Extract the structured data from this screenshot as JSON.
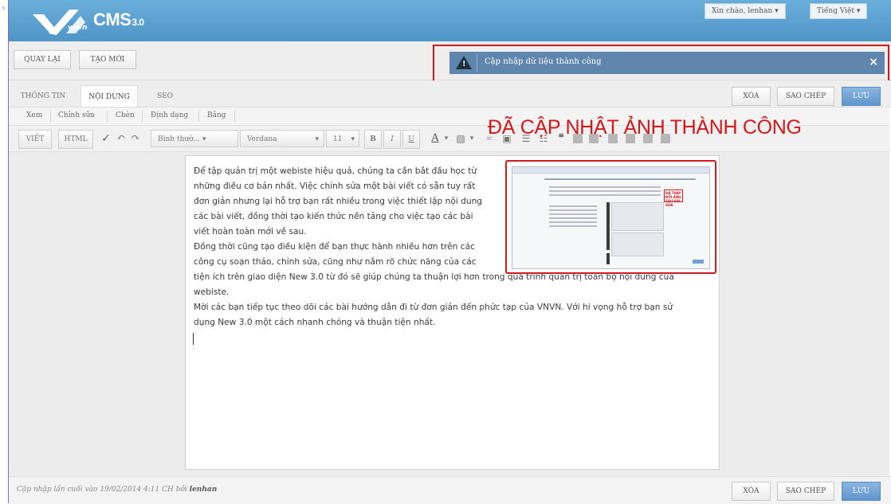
{
  "header": {
    "brand_small": "vnvn",
    "brand_name": "CMS",
    "brand_version": "3.0",
    "greeting": "Xin chào, lenhan",
    "language": "Tiếng Việt"
  },
  "actions": {
    "back": "QUAY LẠI",
    "new": "TẠO MỚI"
  },
  "notice": {
    "message": "Cập nhập dữ liệu thành công",
    "close": "×"
  },
  "annotation": "ĐÃ CẬP NHẬT ẢNH THÀNH CÔNG",
  "tabs": [
    "THÔNG TIN",
    "NỘI DUNG",
    "SEO"
  ],
  "record_actions": {
    "delete": "XÓA",
    "copy": "SAO CHÉP",
    "save": "LƯU"
  },
  "editor": {
    "menu": [
      "Xem",
      "Chỉnh sửa",
      "Chèn",
      "Định dạng",
      "Bảng"
    ],
    "mode_view": "VIẾT",
    "mode_html": "HTML",
    "format_select": "Bình thườ...",
    "font_select": "Verdana",
    "size_select": "11",
    "bold": "B",
    "italic": "I",
    "underline": "U",
    "font_color": "A"
  },
  "content": {
    "lines": [
      "Để tập quản trị một webiste hiệu quả, chúng ta cần bắt đầu học từ",
      "những điều cơ bản nhất. Việc chỉnh sửa một bài viết có sẵn tuy rất",
      "đơn giản nhưng lại hỗ trợ bạn rất nhiều trong việc thiết lập nội dung",
      "các bài viết, đồng thời tạo kiến thức nền tảng cho việc tạo các bài",
      "viết hoàn toàn mới về sau.",
      "Đồng thời cũng tạo điều kiện để bạn thực hành nhiều hơn trên các",
      "công cụ soạn thảo, chỉnh sửa, cũng như nắm rõ chức năng của các",
      "tiện ích trên giao diện New 3.0 từ đó sẽ giúp chúng ta thuận lợi hơn trong quá trình quản trị toàn bộ nội dung của",
      "webiste.",
      "Mời các bạn tiếp tục theo dõi các bài hướng dẫn đi từ đơn giản đến phức tạp của VNVN. Với hi vọng hỗ trợ bạn sử",
      "dụng New 3.0 một cách nhanh chóng và thuận tiện nhất."
    ],
    "thumb_label": "ĐÃ THAY ĐỔI ẢNH SAU KHI SỬA"
  },
  "footer": {
    "last_updated_prefix": "Cập nhập lần cuối vào 19/02/2014 4:11 CH bởi",
    "last_updated_user": "lenhan"
  },
  "colors": {
    "header_blue": "#5aa0cf",
    "notice_blue": "#5f86ad",
    "highlight_red": "#d0191c",
    "save_blue": "#6fa3d6"
  }
}
